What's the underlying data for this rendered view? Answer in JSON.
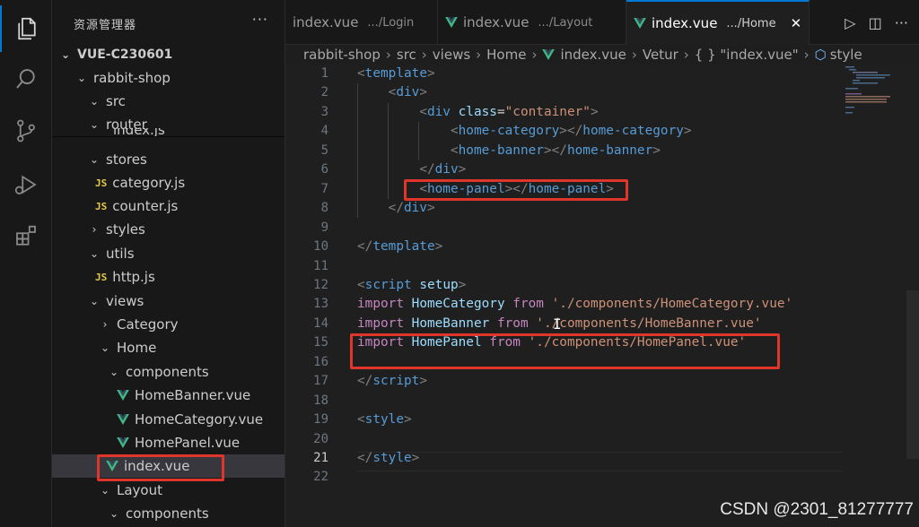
{
  "activity_bar": {
    "icons": [
      "files-icon",
      "search-icon",
      "source-control-icon",
      "run-debug-icon",
      "extensions-icon"
    ]
  },
  "sidebar": {
    "title": "资源管理器",
    "more": "···",
    "sticky_hidden_text": "index.js",
    "tree": [
      {
        "label": "VUE-C230601",
        "kind": "root",
        "chev": "⌄"
      },
      {
        "label": "rabbit-shop",
        "kind": "folder",
        "chev": "⌄"
      },
      {
        "label": "src",
        "kind": "folder",
        "chev": "⌄"
      },
      {
        "label": "router",
        "kind": "folder",
        "chev": "⌄"
      },
      {
        "label": "stores",
        "kind": "folder",
        "chev": "⌄"
      },
      {
        "label": "category.js",
        "kind": "js",
        "badge": "JS"
      },
      {
        "label": "counter.js",
        "kind": "js",
        "badge": "JS"
      },
      {
        "label": "styles",
        "kind": "folder",
        "chev": "›"
      },
      {
        "label": "utils",
        "kind": "folder",
        "chev": "⌄"
      },
      {
        "label": "http.js",
        "kind": "js",
        "badge": "JS"
      },
      {
        "label": "views",
        "kind": "folder",
        "chev": "⌄"
      },
      {
        "label": "Category",
        "kind": "folder",
        "chev": "›"
      },
      {
        "label": "Home",
        "kind": "folder",
        "chev": "⌄"
      },
      {
        "label": "components",
        "kind": "folder",
        "chev": "⌄"
      },
      {
        "label": "HomeBanner.vue",
        "kind": "vue"
      },
      {
        "label": "HomeCategory.vue",
        "kind": "vue"
      },
      {
        "label": "HomePanel.vue",
        "kind": "vue"
      },
      {
        "label": "index.vue",
        "kind": "vue",
        "selected": true
      },
      {
        "label": "Layout",
        "kind": "folder",
        "chev": "⌄"
      },
      {
        "label": "components",
        "kind": "folder",
        "chev": "⌄"
      }
    ]
  },
  "tabs": [
    {
      "label": "index.vue",
      "path": ".../Login",
      "active": false
    },
    {
      "label": "index.vue",
      "path": ".../Layout",
      "active": false
    },
    {
      "label": "index.vue",
      "path": ".../Home",
      "active": true,
      "close": "✕"
    }
  ],
  "tab_actions": {
    "run": "▷",
    "split": "◫",
    "more": "···"
  },
  "breadcrumb": [
    "rabbit-shop",
    "src",
    "views",
    "Home",
    "index.vue",
    "Vetur",
    "{ } \"index.vue\"",
    "style"
  ],
  "editor": {
    "current_line": 21,
    "lines": [
      {
        "n": "1",
        "tokens": [
          [
            "t-punc",
            "<"
          ],
          [
            "t-tag",
            "template"
          ],
          [
            "t-punc",
            ">"
          ]
        ]
      },
      {
        "n": "2",
        "tokens": [
          [
            "",
            "    "
          ],
          [
            "t-punc",
            "<"
          ],
          [
            "t-tag",
            "div"
          ],
          [
            "t-punc",
            ">"
          ]
        ]
      },
      {
        "n": "3",
        "tokens": [
          [
            "",
            "        "
          ],
          [
            "t-punc",
            "<"
          ],
          [
            "t-tag",
            "div "
          ],
          [
            "t-attr",
            "class"
          ],
          [
            "",
            "="
          ],
          [
            "t-str",
            "\"container\""
          ],
          [
            "t-punc",
            ">"
          ]
        ]
      },
      {
        "n": "4",
        "tokens": [
          [
            "",
            "            "
          ],
          [
            "t-punc",
            "<"
          ],
          [
            "t-tag",
            "home-category"
          ],
          [
            "t-punc",
            "></"
          ],
          [
            "t-tag",
            "home-category"
          ],
          [
            "t-punc",
            ">"
          ]
        ]
      },
      {
        "n": "5",
        "tokens": [
          [
            "",
            "            "
          ],
          [
            "t-punc",
            "<"
          ],
          [
            "t-tag",
            "home-banner"
          ],
          [
            "t-punc",
            "></"
          ],
          [
            "t-tag",
            "home-banner"
          ],
          [
            "t-punc",
            ">"
          ]
        ]
      },
      {
        "n": "6",
        "tokens": [
          [
            "",
            "        "
          ],
          [
            "t-punc",
            "</"
          ],
          [
            "t-tag",
            "div"
          ],
          [
            "t-punc",
            ">"
          ]
        ]
      },
      {
        "n": "7",
        "tokens": [
          [
            "",
            "        "
          ],
          [
            "t-punc",
            "<"
          ],
          [
            "t-tag",
            "home-panel"
          ],
          [
            "t-punc",
            "></"
          ],
          [
            "t-tag",
            "home-panel"
          ],
          [
            "t-punc",
            ">"
          ]
        ]
      },
      {
        "n": "8",
        "tokens": [
          [
            "",
            "    "
          ],
          [
            "t-punc",
            "</"
          ],
          [
            "t-tag",
            "div"
          ],
          [
            "t-punc",
            ">"
          ]
        ]
      },
      {
        "n": "9",
        "tokens": []
      },
      {
        "n": "10",
        "tokens": [
          [
            "t-punc",
            "</"
          ],
          [
            "t-tag",
            "template"
          ],
          [
            "t-punc",
            ">"
          ]
        ]
      },
      {
        "n": "11",
        "tokens": []
      },
      {
        "n": "12",
        "tokens": [
          [
            "t-punc",
            "<"
          ],
          [
            "t-tag",
            "script "
          ],
          [
            "t-attr",
            "setup"
          ],
          [
            "t-punc",
            ">"
          ]
        ]
      },
      {
        "n": "13",
        "tokens": [
          [
            "t-kw",
            "import "
          ],
          [
            "t-id",
            "HomeCategory "
          ],
          [
            "t-kw",
            "from "
          ],
          [
            "t-str",
            "'./components/HomeCategory.vue'"
          ]
        ]
      },
      {
        "n": "14",
        "tokens": [
          [
            "t-kw",
            "import "
          ],
          [
            "t-id",
            "HomeBanner "
          ],
          [
            "t-kw",
            "from "
          ],
          [
            "t-str",
            "'./components/HomeBanner.vue'"
          ]
        ]
      },
      {
        "n": "15",
        "tokens": [
          [
            "t-kw",
            "import "
          ],
          [
            "t-id",
            "HomePanel "
          ],
          [
            "t-kw",
            "from "
          ],
          [
            "t-str",
            "'./components/HomePanel.vue'"
          ]
        ]
      },
      {
        "n": "16",
        "tokens": []
      },
      {
        "n": "17",
        "tokens": [
          [
            "t-punc",
            "</"
          ],
          [
            "t-tag",
            "script"
          ],
          [
            "t-punc",
            ">"
          ]
        ]
      },
      {
        "n": "18",
        "tokens": []
      },
      {
        "n": "19",
        "tokens": [
          [
            "t-punc",
            "<"
          ],
          [
            "t-tag",
            "style"
          ],
          [
            "t-punc",
            ">"
          ]
        ]
      },
      {
        "n": "20",
        "tokens": []
      },
      {
        "n": "21",
        "tokens": [
          [
            "t-punc",
            "</"
          ],
          [
            "t-tag",
            "style"
          ],
          [
            "t-punc",
            ">"
          ]
        ]
      },
      {
        "n": "22",
        "tokens": []
      }
    ]
  },
  "watermark": "CSDN @2301_81277777",
  "colors": {
    "accent": "#0078d4",
    "highlight_box": "#e0352b",
    "vue_green": "#41b883",
    "js_yellow": "#e6c84c"
  }
}
